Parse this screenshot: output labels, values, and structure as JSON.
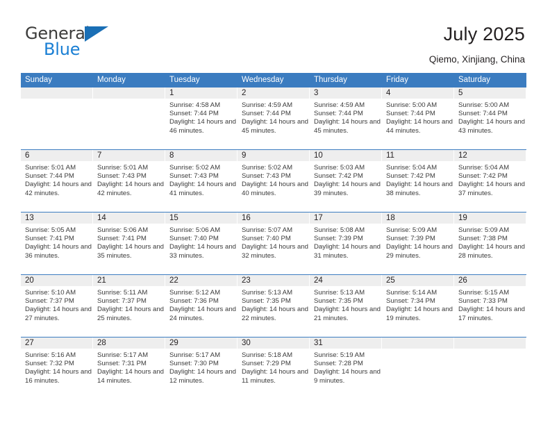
{
  "brand": {
    "word_one": "General",
    "word_two": "Blue",
    "triangle_color": "#1a6fb5",
    "blue_text_color": "#1a7fd4"
  },
  "header": {
    "title": "July 2025",
    "subtitle": "Qiemo, Xinjiang, China"
  },
  "theme": {
    "header_blue": "#3b7cc0",
    "band_gray": "#eeeeee"
  },
  "weekday_headers": [
    "Sunday",
    "Monday",
    "Tuesday",
    "Wednesday",
    "Thursday",
    "Friday",
    "Saturday"
  ],
  "weeks": [
    [
      {
        "date": "",
        "sunrise": "",
        "sunset": "",
        "daylight": "",
        "empty": true
      },
      {
        "date": "",
        "sunrise": "",
        "sunset": "",
        "daylight": "",
        "empty": true
      },
      {
        "date": "1",
        "sunrise": "Sunrise: 4:58 AM",
        "sunset": "Sunset: 7:44 PM",
        "daylight": "Daylight: 14 hours and 46 minutes.",
        "empty": false
      },
      {
        "date": "2",
        "sunrise": "Sunrise: 4:59 AM",
        "sunset": "Sunset: 7:44 PM",
        "daylight": "Daylight: 14 hours and 45 minutes.",
        "empty": false
      },
      {
        "date": "3",
        "sunrise": "Sunrise: 4:59 AM",
        "sunset": "Sunset: 7:44 PM",
        "daylight": "Daylight: 14 hours and 45 minutes.",
        "empty": false
      },
      {
        "date": "4",
        "sunrise": "Sunrise: 5:00 AM",
        "sunset": "Sunset: 7:44 PM",
        "daylight": "Daylight: 14 hours and 44 minutes.",
        "empty": false
      },
      {
        "date": "5",
        "sunrise": "Sunrise: 5:00 AM",
        "sunset": "Sunset: 7:44 PM",
        "daylight": "Daylight: 14 hours and 43 minutes.",
        "empty": false
      }
    ],
    [
      {
        "date": "6",
        "sunrise": "Sunrise: 5:01 AM",
        "sunset": "Sunset: 7:44 PM",
        "daylight": "Daylight: 14 hours and 42 minutes.",
        "empty": false
      },
      {
        "date": "7",
        "sunrise": "Sunrise: 5:01 AM",
        "sunset": "Sunset: 7:43 PM",
        "daylight": "Daylight: 14 hours and 42 minutes.",
        "empty": false
      },
      {
        "date": "8",
        "sunrise": "Sunrise: 5:02 AM",
        "sunset": "Sunset: 7:43 PM",
        "daylight": "Daylight: 14 hours and 41 minutes.",
        "empty": false
      },
      {
        "date": "9",
        "sunrise": "Sunrise: 5:02 AM",
        "sunset": "Sunset: 7:43 PM",
        "daylight": "Daylight: 14 hours and 40 minutes.",
        "empty": false
      },
      {
        "date": "10",
        "sunrise": "Sunrise: 5:03 AM",
        "sunset": "Sunset: 7:42 PM",
        "daylight": "Daylight: 14 hours and 39 minutes.",
        "empty": false
      },
      {
        "date": "11",
        "sunrise": "Sunrise: 5:04 AM",
        "sunset": "Sunset: 7:42 PM",
        "daylight": "Daylight: 14 hours and 38 minutes.",
        "empty": false
      },
      {
        "date": "12",
        "sunrise": "Sunrise: 5:04 AM",
        "sunset": "Sunset: 7:42 PM",
        "daylight": "Daylight: 14 hours and 37 minutes.",
        "empty": false
      }
    ],
    [
      {
        "date": "13",
        "sunrise": "Sunrise: 5:05 AM",
        "sunset": "Sunset: 7:41 PM",
        "daylight": "Daylight: 14 hours and 36 minutes.",
        "empty": false
      },
      {
        "date": "14",
        "sunrise": "Sunrise: 5:06 AM",
        "sunset": "Sunset: 7:41 PM",
        "daylight": "Daylight: 14 hours and 35 minutes.",
        "empty": false
      },
      {
        "date": "15",
        "sunrise": "Sunrise: 5:06 AM",
        "sunset": "Sunset: 7:40 PM",
        "daylight": "Daylight: 14 hours and 33 minutes.",
        "empty": false
      },
      {
        "date": "16",
        "sunrise": "Sunrise: 5:07 AM",
        "sunset": "Sunset: 7:40 PM",
        "daylight": "Daylight: 14 hours and 32 minutes.",
        "empty": false
      },
      {
        "date": "17",
        "sunrise": "Sunrise: 5:08 AM",
        "sunset": "Sunset: 7:39 PM",
        "daylight": "Daylight: 14 hours and 31 minutes.",
        "empty": false
      },
      {
        "date": "18",
        "sunrise": "Sunrise: 5:09 AM",
        "sunset": "Sunset: 7:39 PM",
        "daylight": "Daylight: 14 hours and 29 minutes.",
        "empty": false
      },
      {
        "date": "19",
        "sunrise": "Sunrise: 5:09 AM",
        "sunset": "Sunset: 7:38 PM",
        "daylight": "Daylight: 14 hours and 28 minutes.",
        "empty": false
      }
    ],
    [
      {
        "date": "20",
        "sunrise": "Sunrise: 5:10 AM",
        "sunset": "Sunset: 7:37 PM",
        "daylight": "Daylight: 14 hours and 27 minutes.",
        "empty": false
      },
      {
        "date": "21",
        "sunrise": "Sunrise: 5:11 AM",
        "sunset": "Sunset: 7:37 PM",
        "daylight": "Daylight: 14 hours and 25 minutes.",
        "empty": false
      },
      {
        "date": "22",
        "sunrise": "Sunrise: 5:12 AM",
        "sunset": "Sunset: 7:36 PM",
        "daylight": "Daylight: 14 hours and 24 minutes.",
        "empty": false
      },
      {
        "date": "23",
        "sunrise": "Sunrise: 5:13 AM",
        "sunset": "Sunset: 7:35 PM",
        "daylight": "Daylight: 14 hours and 22 minutes.",
        "empty": false
      },
      {
        "date": "24",
        "sunrise": "Sunrise: 5:13 AM",
        "sunset": "Sunset: 7:35 PM",
        "daylight": "Daylight: 14 hours and 21 minutes.",
        "empty": false
      },
      {
        "date": "25",
        "sunrise": "Sunrise: 5:14 AM",
        "sunset": "Sunset: 7:34 PM",
        "daylight": "Daylight: 14 hours and 19 minutes.",
        "empty": false
      },
      {
        "date": "26",
        "sunrise": "Sunrise: 5:15 AM",
        "sunset": "Sunset: 7:33 PM",
        "daylight": "Daylight: 14 hours and 17 minutes.",
        "empty": false
      }
    ],
    [
      {
        "date": "27",
        "sunrise": "Sunrise: 5:16 AM",
        "sunset": "Sunset: 7:32 PM",
        "daylight": "Daylight: 14 hours and 16 minutes.",
        "empty": false
      },
      {
        "date": "28",
        "sunrise": "Sunrise: 5:17 AM",
        "sunset": "Sunset: 7:31 PM",
        "daylight": "Daylight: 14 hours and 14 minutes.",
        "empty": false
      },
      {
        "date": "29",
        "sunrise": "Sunrise: 5:17 AM",
        "sunset": "Sunset: 7:30 PM",
        "daylight": "Daylight: 14 hours and 12 minutes.",
        "empty": false
      },
      {
        "date": "30",
        "sunrise": "Sunrise: 5:18 AM",
        "sunset": "Sunset: 7:29 PM",
        "daylight": "Daylight: 14 hours and 11 minutes.",
        "empty": false
      },
      {
        "date": "31",
        "sunrise": "Sunrise: 5:19 AM",
        "sunset": "Sunset: 7:28 PM",
        "daylight": "Daylight: 14 hours and 9 minutes.",
        "empty": false
      },
      {
        "date": "",
        "sunrise": "",
        "sunset": "",
        "daylight": "",
        "empty": true
      },
      {
        "date": "",
        "sunrise": "",
        "sunset": "",
        "daylight": "",
        "empty": true
      }
    ]
  ]
}
